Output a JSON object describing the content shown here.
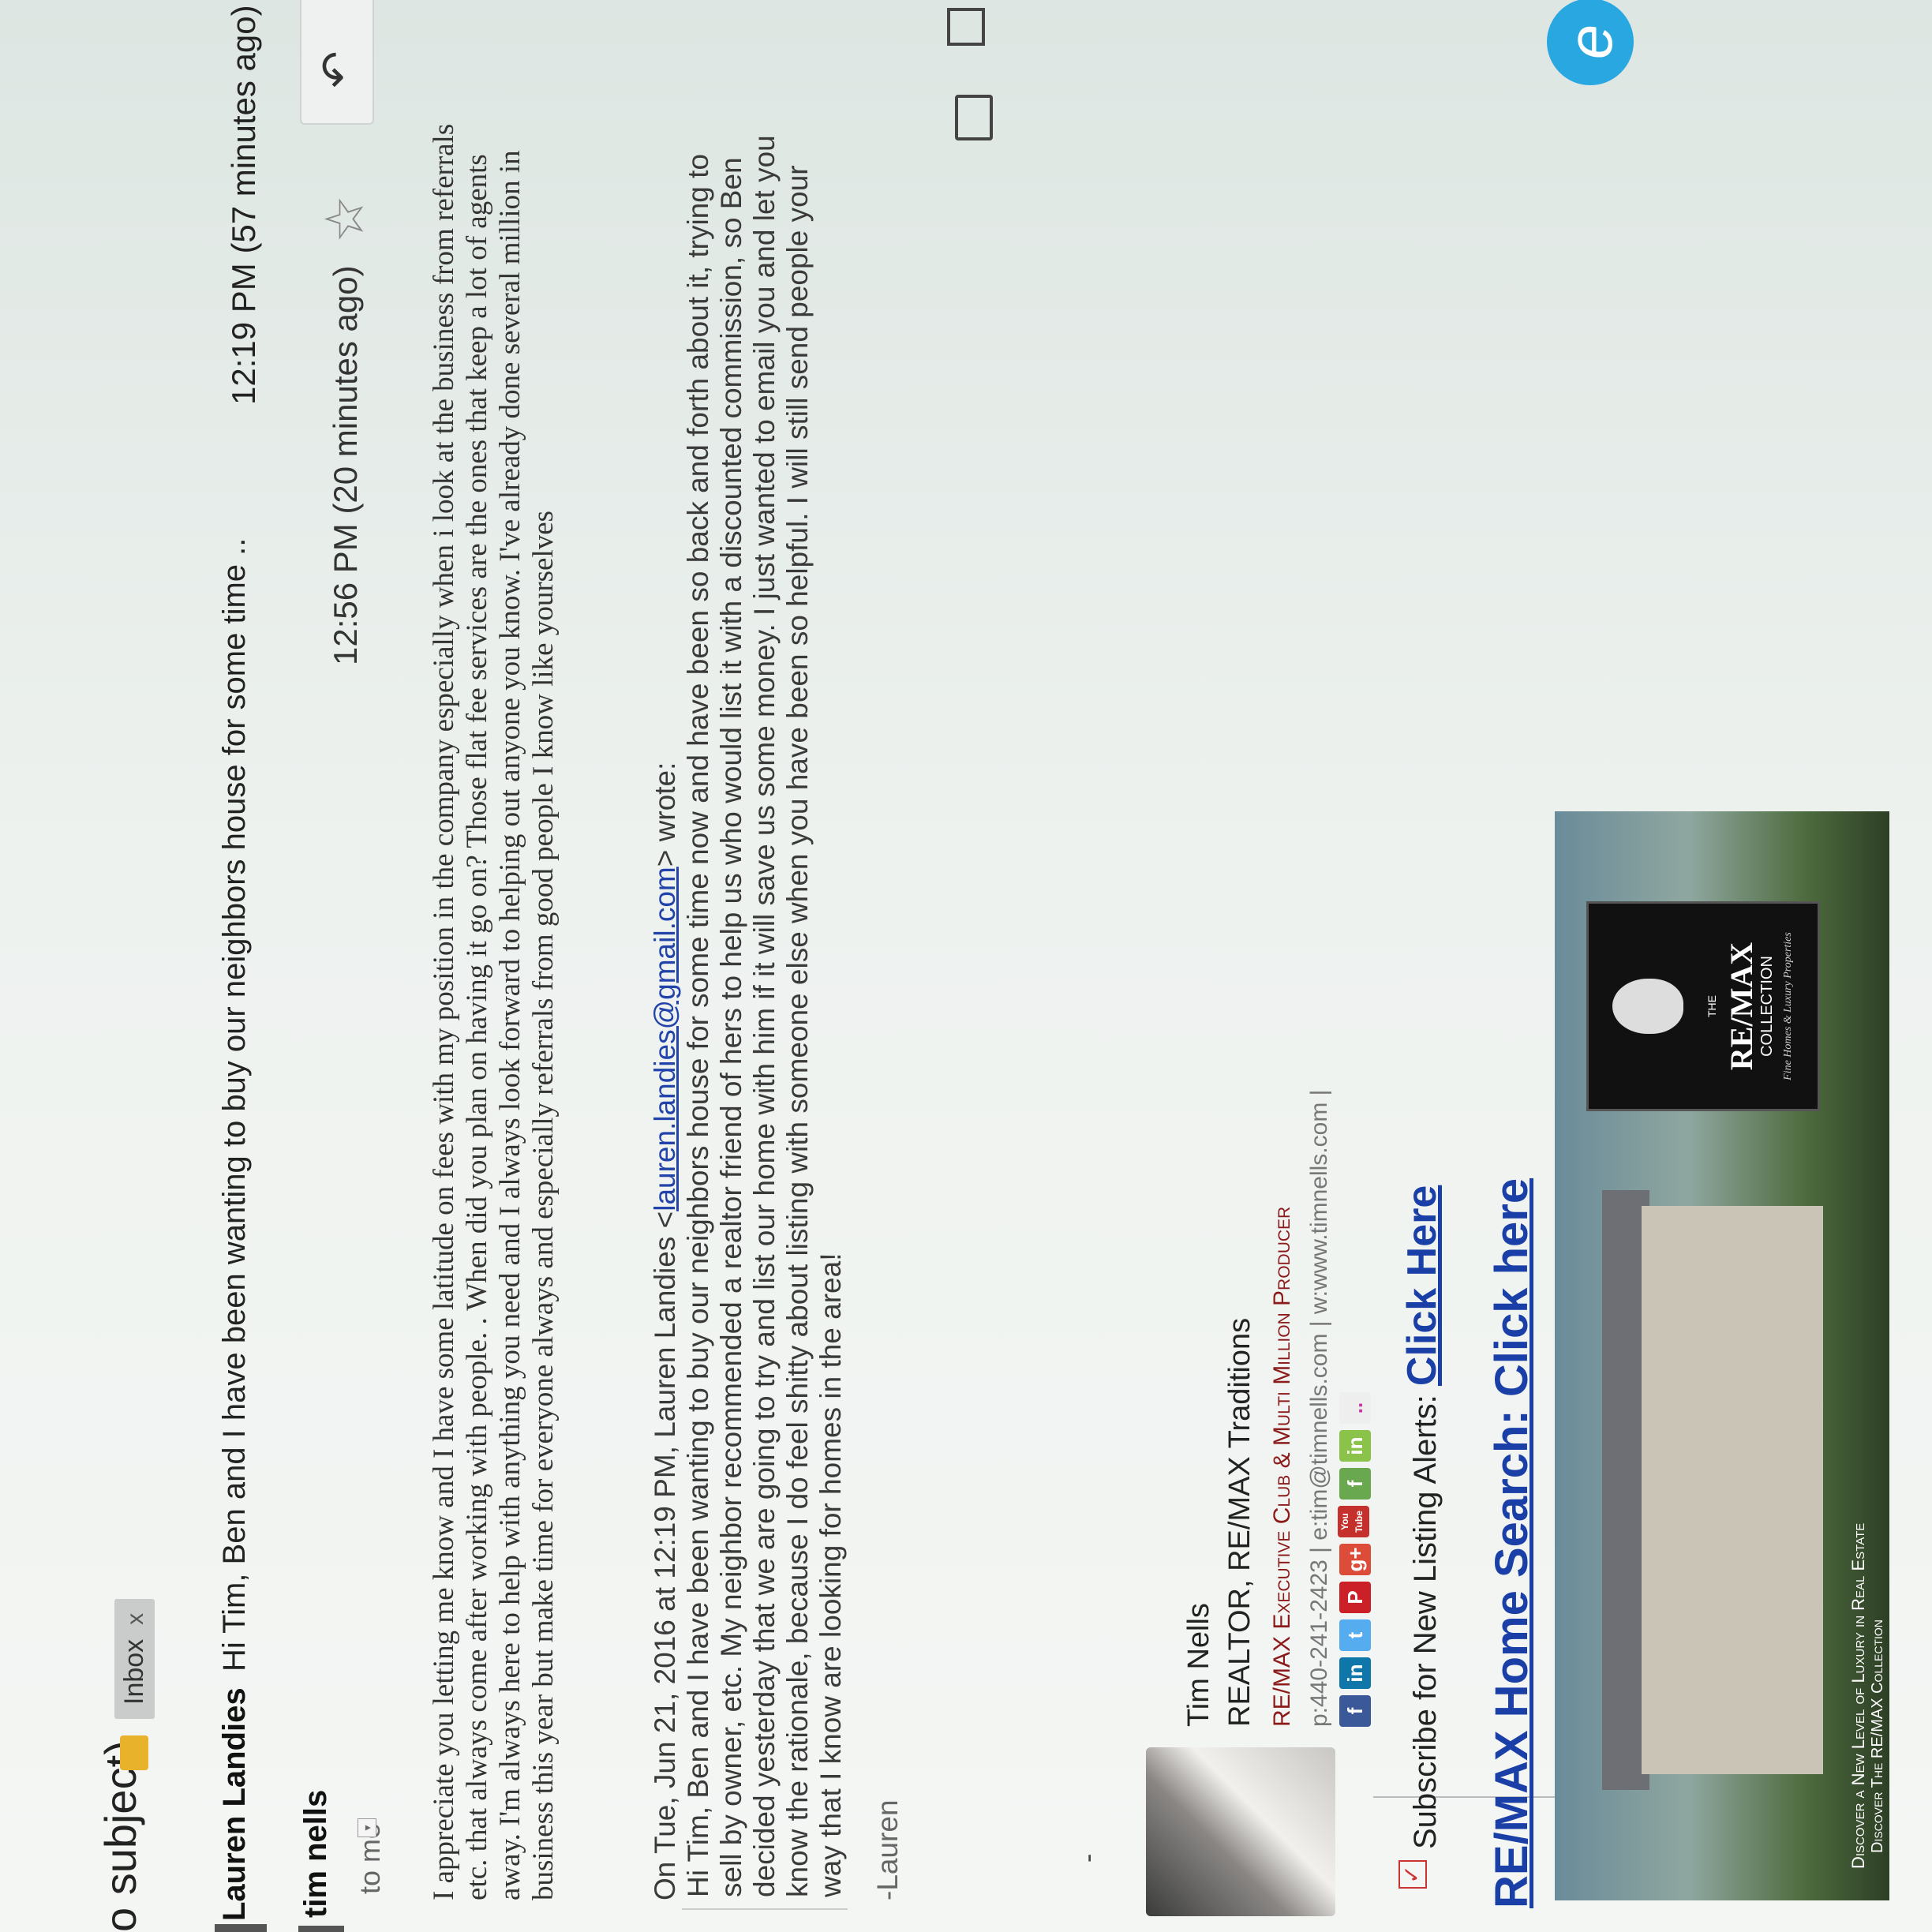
{
  "header": {
    "subject_prefix": "o subject)",
    "inbox_label": "Inbox",
    "inbox_close": "x"
  },
  "thread": {
    "sender": "Lauren Landies",
    "snippet": "Hi Tim, Ben and I have been wanting to buy our neighbors house for some time ..",
    "time": "12:19 PM (57 minutes ago)"
  },
  "message": {
    "sender": "tim nells",
    "recipient": "to me",
    "time": "12:56 PM (20 minutes ago)",
    "body": "I appreciate you letting me know and I have some latitude on fees with my position in the company especially when i look at the business from referrals etc. that always come after working with people. . When did you plan on having it go on? Those flat fee services are the ones that keep a lot of agents away. I'm always here to help with anything you need and I always look forward to helping out anyone you know. I've already done several million in business this year but make time for everyone always and especially referrals from good people I know like yourselves"
  },
  "quote": {
    "header_prefix": "On Tue, Jun 21, 2016 at 12:19 PM, Lauren Landies <",
    "email": "lauren.landies@gmail.com",
    "header_suffix": "> wrote:",
    "body": "Hi Tim, Ben and I have been wanting to buy our neighbors house for some time now and have been so back and forth about it, trying to sell by owner, etc. My neighbor recommended a realtor friend of hers to help us who would list it with a discounted commission, so Ben decided yesterday that we are going to try and list our home with him if it will save us some money. I just wanted to email you and let you know the rationale, because I do feel shitty about listing with someone else when you have been so helpful. I will still send people your way that I know are looking for homes in the area!",
    "signature": "-Lauren"
  },
  "dash": "-",
  "signature": {
    "name": "Tim Nells",
    "title": "REALTOR, RE/MAX Traditions",
    "club": "RE/MAX Executive Club & Multi Million Producer",
    "contact": "p:440-241-2423 | e:tim@timnells.com | w:www.timnells.com |",
    "subscribe_text": "Subscribe for New Listing Alerts:",
    "subscribe_link": "Click Here",
    "search_link": "RE/MAX Home Search: Click here",
    "social": [
      "f",
      "in",
      "t",
      "P",
      "g+",
      "You Tube",
      "f",
      "in",
      ".."
    ]
  },
  "banner": {
    "tagline": "Discover a New Level of Luxury in Real Estate",
    "tagline2": "Discover The RE/MAX Collection",
    "logo": "RE/MAX",
    "logo_prefix": "THE",
    "collection": "COLLECTION",
    "sub": "Fine Homes & Luxury Properties"
  },
  "colors": {
    "link": "#1a3fa6",
    "club": "#8b1a1a",
    "important_tag": "#e8b22b"
  }
}
